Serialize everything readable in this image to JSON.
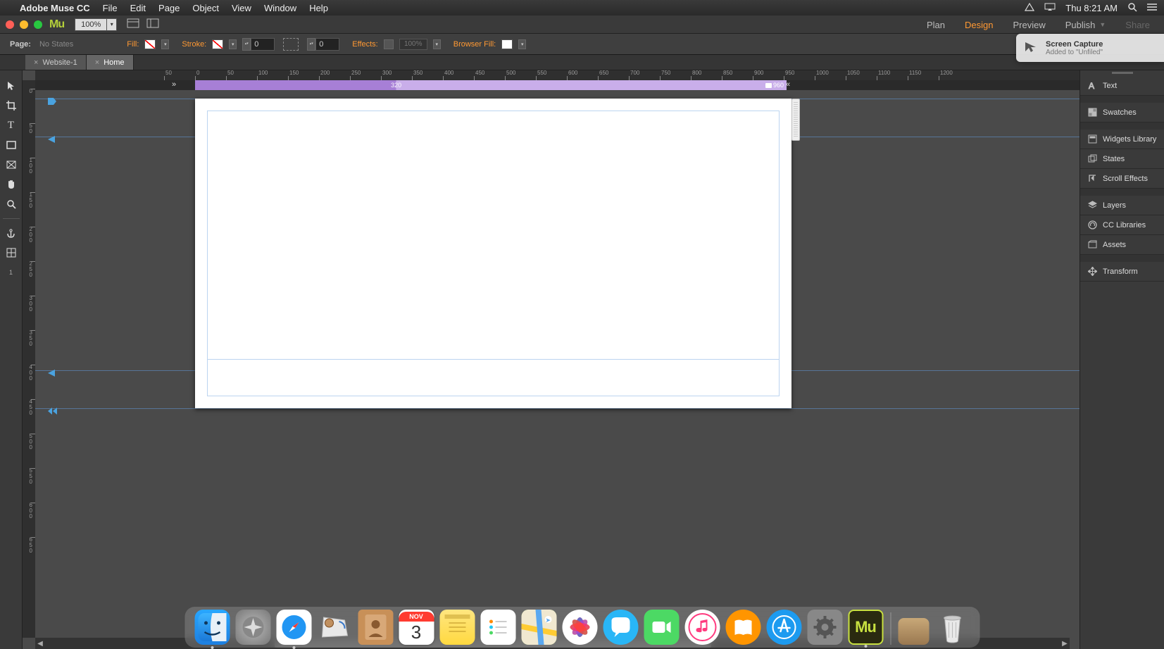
{
  "mac": {
    "app_name": "Adobe Muse CC",
    "menus": [
      "File",
      "Edit",
      "Page",
      "Object",
      "View",
      "Window",
      "Help"
    ],
    "clock": "Thu 8:21 AM"
  },
  "strip": {
    "zoom": "100%"
  },
  "modes": {
    "plan": "Plan",
    "design": "Design",
    "preview": "Preview",
    "publish": "Publish",
    "share": "Share"
  },
  "props": {
    "page_lbl": "Page:",
    "page_state": "No States",
    "fill": "Fill:",
    "stroke": "Stroke:",
    "stroke_val": "0",
    "corner_val": "0",
    "effects": "Effects:",
    "opacity": "100%",
    "browser_fill": "Browser Fill:"
  },
  "tabs": [
    {
      "label": "Website-1",
      "active": false
    },
    {
      "label": "Home",
      "active": true
    }
  ],
  "breakpoints": {
    "mid": "320",
    "max": "960"
  },
  "ruler_h": [
    50,
    100,
    150,
    200,
    250,
    300,
    350,
    400,
    450,
    500,
    550,
    600,
    650,
    700,
    750,
    800,
    850,
    900,
    950,
    1000,
    1050,
    1100,
    1150,
    1200
  ],
  "ruler_v": [
    0,
    50,
    100,
    150,
    200,
    250,
    300,
    350,
    400,
    450,
    500,
    550,
    600,
    650
  ],
  "panels": [
    "Text",
    "Swatches",
    "Widgets Library",
    "States",
    "Scroll Effects",
    "Layers",
    "CC Libraries",
    "Assets",
    "Transform"
  ],
  "notification": {
    "title": "Screen Capture",
    "sub": "Added to \"Unfiled\""
  },
  "dock": {
    "apps": [
      "finder",
      "launchpad",
      "safari",
      "mail",
      "contacts",
      "calendar",
      "notes",
      "reminders",
      "maps",
      "photos",
      "messages",
      "facetime",
      "itunes",
      "ibooks",
      "appstore",
      "prefs",
      "muse"
    ],
    "running": [
      "finder",
      "safari",
      "muse"
    ],
    "calendar": {
      "month": "NOV",
      "day": "3"
    },
    "extras": [
      "desktop",
      "trash"
    ]
  }
}
